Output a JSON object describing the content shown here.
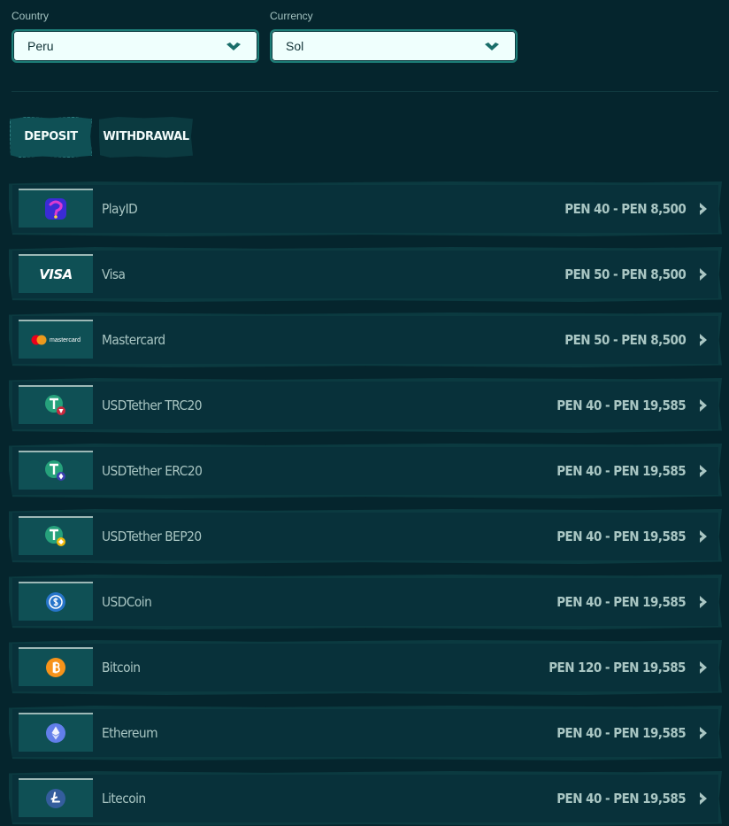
{
  "country": {
    "label": "Country",
    "value": "Peru"
  },
  "currency": {
    "label": "Currency",
    "value": "Sol"
  },
  "tabs": [
    {
      "label": "DEPOSIT",
      "active": true
    },
    {
      "label": "WITHDRAWAL",
      "active": false
    }
  ],
  "methods": [
    {
      "name": "PlayID",
      "range": "PEN 40 - PEN 8,500",
      "icon": "playid-icon"
    },
    {
      "name": "Visa",
      "range": "PEN 50 - PEN 8,500",
      "icon": "visa-logo-icon",
      "logo_text": "VISA"
    },
    {
      "name": "Mastercard",
      "range": "PEN 50 - PEN 8,500",
      "icon": "mastercard-logo-icon",
      "logo_text": "mastercard"
    },
    {
      "name": "USDTether TRC20",
      "range": "PEN 40 - PEN 19,585",
      "icon": "tether-trc20-icon"
    },
    {
      "name": "USDTether ERC20",
      "range": "PEN 40 - PEN 19,585",
      "icon": "tether-erc20-icon"
    },
    {
      "name": "USDTether BEP20",
      "range": "PEN 40 - PEN 19,585",
      "icon": "tether-bep20-icon"
    },
    {
      "name": "USDCoin",
      "range": "PEN 40 - PEN 19,585",
      "icon": "usdcoin-icon"
    },
    {
      "name": "Bitcoin",
      "range": "PEN 120 - PEN 19,585",
      "icon": "bitcoin-icon"
    },
    {
      "name": "Ethereum",
      "range": "PEN 40 - PEN 19,585",
      "icon": "ethereum-icon"
    },
    {
      "name": "Litecoin",
      "range": "PEN 40 - PEN 19,585",
      "icon": "litecoin-icon"
    }
  ],
  "colors": {
    "background": "#05252d",
    "row": "#08313a",
    "logo_bg": "#0f5055",
    "accent": "#1d7d77",
    "text_muted": "#a9c6c3"
  }
}
